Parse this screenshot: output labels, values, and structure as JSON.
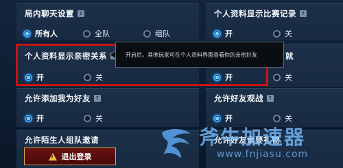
{
  "sections": {
    "lobby_chat": {
      "title": "局内聊天设置",
      "options": [
        "所有人",
        "全队",
        "组队"
      ],
      "selected": "所有人"
    },
    "show_match_record": {
      "title": "个人资料显示比赛记录",
      "options": [
        "开",
        "关"
      ],
      "selected": "开"
    },
    "show_intimate": {
      "title": "个人资料显示亲密关系",
      "options": [
        "开",
        "关"
      ],
      "selected": "开"
    },
    "show_achievement": {
      "title_suffix": "就",
      "options": [
        "开",
        "关"
      ],
      "selected": "开"
    },
    "allow_add_friend": {
      "title": "允许添加我为好友",
      "options": [
        "开",
        "关"
      ],
      "selected": "开"
    },
    "allow_friend_spectate": {
      "title": "允许好友观战",
      "options": [
        "开",
        "关"
      ],
      "selected": "开"
    },
    "allow_stranger_invite": {
      "title": "允许陌生人组队邀请"
    },
    "allow_friend_gift": {
      "title": "允许好友索要礼物"
    }
  },
  "tooltip": {
    "text": "开启后，其他玩家可在个人资料界面查看你的亲密好友"
  },
  "logout": {
    "label": "退出登录"
  },
  "watermark": {
    "brand": "斧牛加速器",
    "url": "www.fnjiasu.com"
  },
  "colors": {
    "accent": "#37a6ff",
    "highlight": "#c81414",
    "logout_bg": "#5a0d0d"
  }
}
